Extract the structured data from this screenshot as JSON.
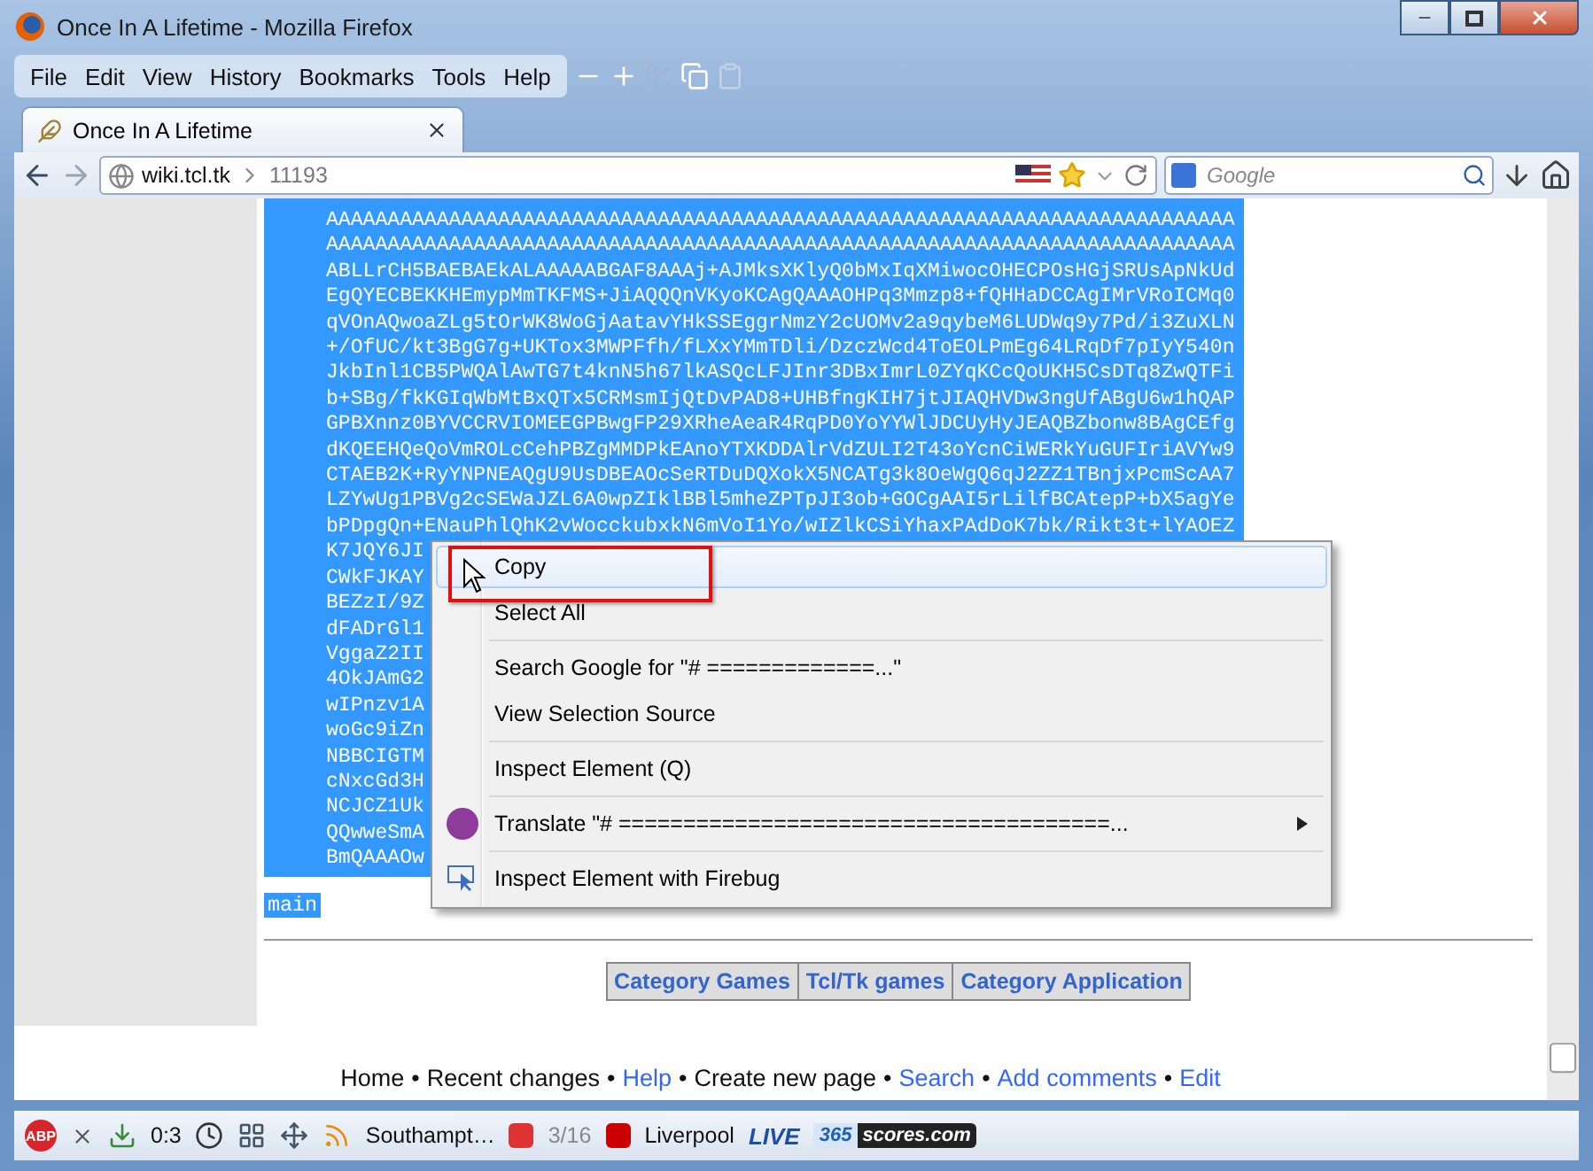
{
  "window": {
    "title": "Once In A Lifetime - Mozilla Firefox"
  },
  "menu_bar": {
    "items": [
      "File",
      "Edit",
      "View",
      "History",
      "Bookmarks",
      "Tools",
      "Help"
    ]
  },
  "tabs": [
    {
      "title": "Once In A Lifetime",
      "selected": true
    }
  ],
  "address_bar": {
    "domain": "wiki.tcl.tk",
    "path": "11193"
  },
  "search": {
    "placeholder": "Google"
  },
  "code_lines": [
    "AAAAAAAAAAAAAAAAAAAAAAAAAAAAAAAAAAAAAAAAAAAAAAAAAAAAAAAAAAAAAAAAAAAAAAAAAA",
    "AAAAAAAAAAAAAAAAAAAAAAAAAAAAAAAAAAAAAAAAAAAAAAAAAAAAAAAAAAAAAAAAAAAAAAAAAA",
    "ABLLrCH5BAEBAEkALAAAAABGAF8AAAj+AJMksXKlyQ0bMxIqXMiwocOHECPOsHGjSRUsApNkUd",
    "EgQYECBEKKHEmypMmTKFMS+JiAQQQnVKyoKCAgQAAAOHPq3Mmzp8+fQHHaDCCAgIMrVRoICMq0",
    "qVOnAQwoaZLg5tOrWK8WoGjAatavYHkSSEggrNmzY2cUOMv2a9qybeM6LUDWq9y7Pd/i3ZuXLN",
    "+/OfUC/kt3BgG7g+UKTox3MWPFfh/fLXxYMmTDli/DzczWcd4ToEOLPmEg64LRqDf7pIyY540n",
    "JkbInl1CB5PWQAlAwTG7t4knN5h67lkASQcLFJInr3DBxImrL0ZYqKCcQoUKH5CsDTq8ZwQTFi",
    "b+SBg/fkKGIqWbMtBxQTx5CRMsmIjQtDvPAD8+UHBfngKIH7jtJIAQHVDw3ngUfABgU6w1hQAP",
    "GPBXnnz0BYVCCRVIOMEEGPBwgFP29XRheAeaR4RqPD0YoYYWlJDCUyHyJEAQBZbonw8BAgCEfg",
    "dKQEEHQeQoVmROLcCehPBZgMMDPkEAnoYTXKDDAlrVdZULI2T43oYcnCiWERkYuGUFIriAVYw9",
    "CTAEB2K+RyYNPNEAQgU9UsDBEAOcSeRTDuDQXokX5NCATg3k8OeWgQ6qJ2ZZ1TBnjxPcmScAA7",
    "LZYwUg1PBVg2cSEWaJZL6A0wpZIklBBl5mheZPTpJI3ob+GOCgAAI5rLilfBCAtepP+bX5agYe",
    "bPDpgQn+ENauPhlQhK2vWocckubxkN6mVoI1Yo/wIZlkCSiYhaxPAdDoK7bk/Rikt3t+lYAOEZ",
    "K7JQY6JI",
    "CWkFJKAY",
    "BEZzI/9Z",
    "dFADrGl1",
    "VggaZ2II",
    "4OkJAmG2",
    "wIPnzv1A",
    "woGc9iZn",
    "NBBCIGTM",
    "cNxcGd3H",
    "NCJCZ1Uk",
    "QQwweSmA",
    "BmQAAAOw"
  ],
  "selected_tag": "main",
  "categories": [
    "Category Games",
    "Tcl/Tk games",
    "Category Application"
  ],
  "footer": {
    "separator": "•",
    "links": [
      {
        "text": "Home",
        "kind": "text"
      },
      {
        "text": "Recent changes",
        "kind": "text"
      },
      {
        "text": "Help",
        "kind": "link"
      },
      {
        "text": "Create new page",
        "kind": "text"
      },
      {
        "text": "Search",
        "kind": "link"
      },
      {
        "text": "Add comments",
        "kind": "link"
      },
      {
        "text": "Edit",
        "kind": "link"
      }
    ]
  },
  "context_menu": {
    "items": [
      {
        "kind": "item",
        "label": "Copy",
        "hovered": true,
        "annotated": true,
        "submenu": false
      },
      {
        "kind": "item",
        "label": "Select All",
        "hovered": false,
        "annotated": false,
        "submenu": false
      },
      {
        "kind": "separator"
      },
      {
        "kind": "item",
        "label": "Search Google for \"# =============...\"",
        "hovered": false,
        "annotated": false,
        "submenu": false
      },
      {
        "kind": "item",
        "label": "View Selection Source",
        "hovered": false,
        "annotated": false,
        "submenu": false
      },
      {
        "kind": "separator"
      },
      {
        "kind": "item",
        "label": "Inspect Element (Q)",
        "hovered": false,
        "annotated": false,
        "submenu": false
      },
      {
        "kind": "separator"
      },
      {
        "kind": "addon",
        "label": "Translate \"# ======================================...",
        "hovered": false,
        "annotated": false,
        "submenu": true
      },
      {
        "kind": "separator"
      },
      {
        "kind": "firebug",
        "label": "Inspect Element with Firebug",
        "hovered": false,
        "annotated": false,
        "submenu": false
      }
    ]
  },
  "addon_bar": {
    "abp_label": "ABP",
    "counter": "0:3",
    "match": {
      "home": "Southampt…",
      "score": "3/16",
      "away": "Liverpool"
    },
    "live_label": "LIVE",
    "scores_logo": [
      "365",
      "scores.com"
    ]
  }
}
